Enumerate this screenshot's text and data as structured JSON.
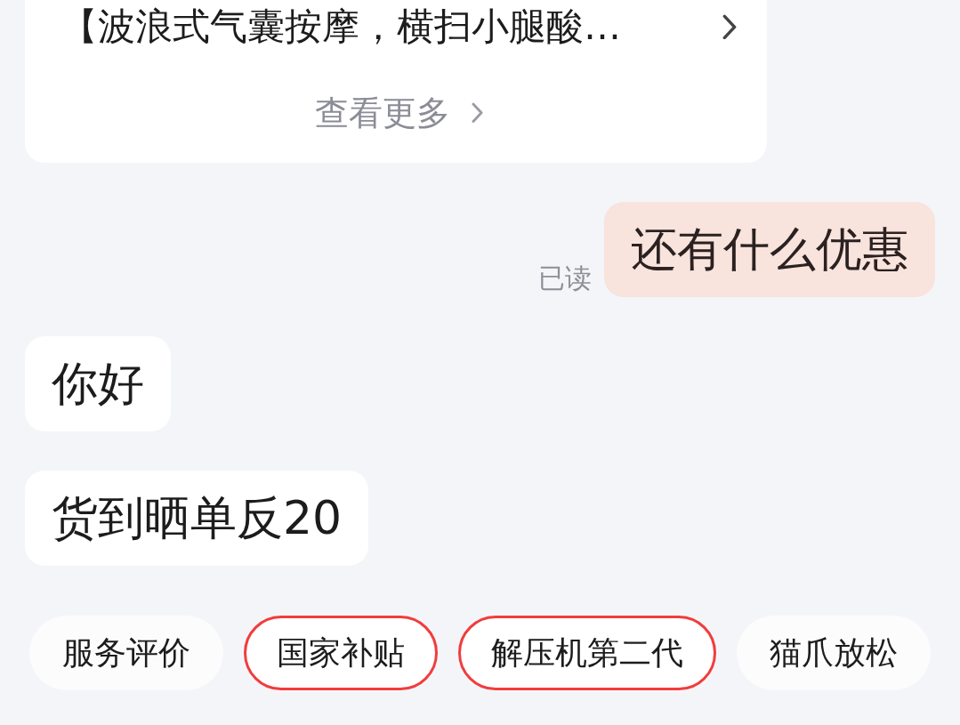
{
  "product_card": {
    "title": "【波浪式气囊按摩，横扫小腿酸…",
    "more_link": "查看更多"
  },
  "messages": [
    {
      "kind": "outgoing",
      "text": "还有什么优惠",
      "read_status": "已读"
    },
    {
      "kind": "incoming",
      "text": "你好"
    },
    {
      "kind": "incoming",
      "text": "货到晒单反20"
    }
  ],
  "quick_replies": [
    {
      "label": "服务评价",
      "highlighted": false
    },
    {
      "label": "国家补贴",
      "highlighted": true
    },
    {
      "label": "解压机第二代",
      "highlighted": true
    },
    {
      "label": "猫爪放松",
      "highlighted": false
    }
  ]
}
